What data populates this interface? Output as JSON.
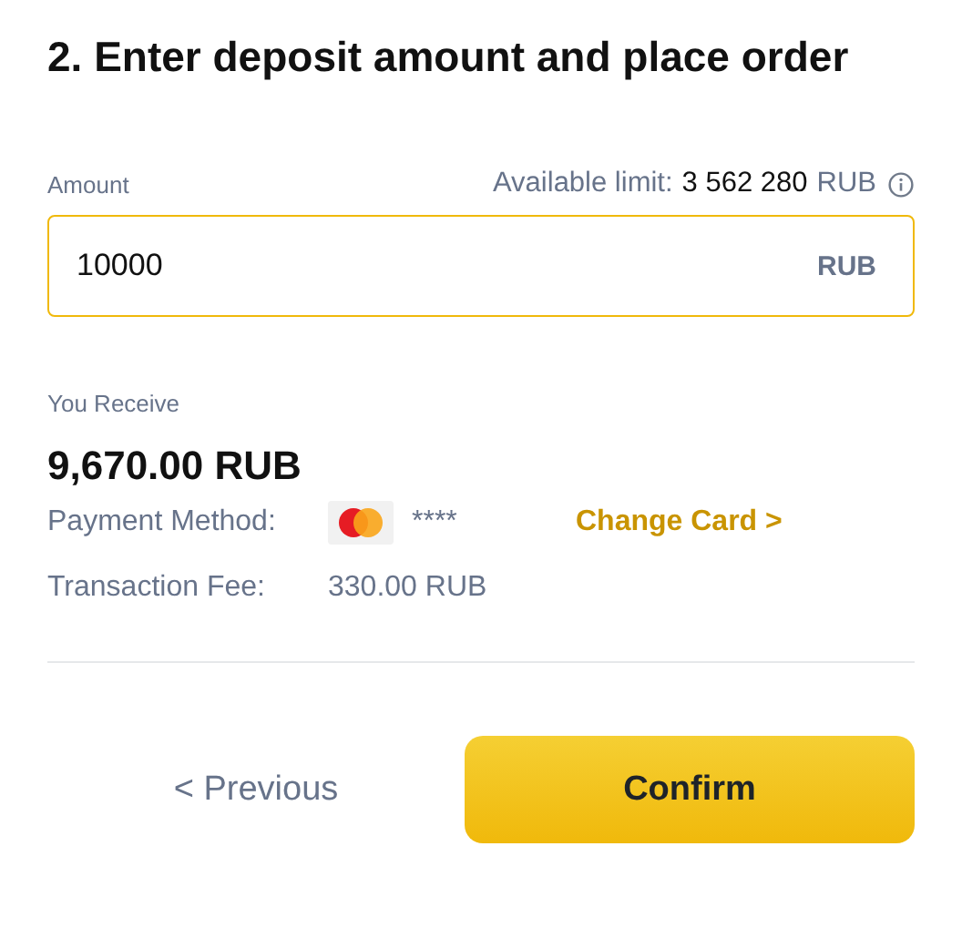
{
  "title": "2. Enter deposit amount and place order",
  "amount": {
    "label": "Amount",
    "limit_label": "Available limit:",
    "limit_value": "3 562 280",
    "limit_currency": "RUB",
    "value": "10000",
    "currency": "RUB"
  },
  "receive": {
    "label": "You Receive",
    "value": "9,670.00 RUB"
  },
  "details": [
    {
      "kind": "card",
      "label": "Payment Method:",
      "value": "****",
      "action": "Change Card >"
    },
    {
      "kind": "text",
      "label": "Transaction Fee:",
      "value": "330.00 RUB"
    }
  ],
  "buttons": {
    "previous": "< Previous",
    "confirm": "Confirm"
  }
}
